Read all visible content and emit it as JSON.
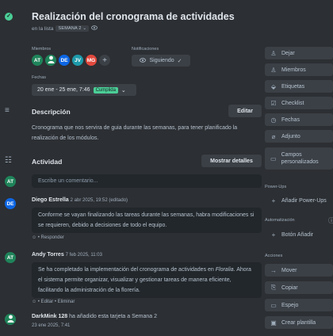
{
  "card": {
    "title": "Realización del cronograma de actividades",
    "in_list_prefix": "en la lista",
    "list_name": "SEMANA 2",
    "list_chevron": "⌄"
  },
  "members": {
    "label": "Miembros",
    "avatars": [
      {
        "initials": "AT",
        "color": "#1f845a"
      },
      {
        "initials": "",
        "color": "#1f845a",
        "icon": "user-icon"
      },
      {
        "initials": "DE",
        "color": "#0c66e4"
      },
      {
        "initials": "JV",
        "color": "#1d9aaa"
      },
      {
        "initials": "MG",
        "color": "#e2483d"
      }
    ]
  },
  "notifications": {
    "label": "Notificaciones",
    "follow_label": "Siguiendo",
    "follow_check": "✓"
  },
  "dates": {
    "label": "Fechas",
    "value": "20 ene - 25 ene, 7:46",
    "status": "Cumplida"
  },
  "description": {
    "title": "Descripción",
    "edit_label": "Editar",
    "text": "Cronograma que nos servira de guia durante las semanas, para tener planificado la realización de los módulos."
  },
  "activity": {
    "title": "Actividad",
    "show_details_label": "Mostrar detalles",
    "comment_placeholder": "Escribe un comentario...",
    "current_user_initials": "AT",
    "current_user_color": "#1f845a",
    "comments": [
      {
        "author": "Diego Estrella",
        "initials": "DE",
        "color": "#0c66e4",
        "meta": "2 abr 2025, 19:52 (editado)",
        "text": "Conforme se vayan finalizando las tareas durante las semanas, habra modificaciones si se requieren, debido a decisiones de todo el equipo.",
        "actions": "☺ • Responder"
      },
      {
        "author": "Andy Torres",
        "initials": "AT",
        "color": "#1f845a",
        "meta": "7 feb 2025, 11:03",
        "text_before": "Se ha completado la implementación del cronograma de actividades en ",
        "text_italic": "Floralia",
        "text_after": ". Ahora el sistema permite organizar, visualizar y gestionar tareas de manera eficiente, facilitando la administración de la florería.",
        "actions": "☺ • Editar • Eliminar"
      }
    ],
    "log": {
      "author": "DarkMink 128",
      "action": "ha añadido esta tarjeta a Semana 2",
      "time": "23 ene 2025, 7:41"
    }
  },
  "sidebar": {
    "buttons": [
      {
        "label": "Dejar",
        "icon": "user-icon"
      },
      {
        "label": "Miembros",
        "icon": "user-icon"
      },
      {
        "label": "Etiquetas",
        "icon": "tag-icon"
      },
      {
        "label": "Checklist",
        "icon": "checklist-icon"
      },
      {
        "label": "Fechas",
        "icon": "clock-icon"
      },
      {
        "label": "Adjunto",
        "icon": "paperclip-icon"
      },
      {
        "label": "Campos personalizados",
        "icon": "fields-icon"
      }
    ],
    "powerups_label": "Power-Ups",
    "add_powerups": "Añadir Power-Ups",
    "automation_label": "Automatización",
    "add_button": "Botón Añadir",
    "actions_label": "Acciones",
    "actions": [
      {
        "label": "Mover",
        "icon": "arrow-right-icon"
      },
      {
        "label": "Copiar",
        "icon": "copy-icon"
      },
      {
        "label": "Espejo",
        "icon": "mirror-icon"
      },
      {
        "label": "Crear plantilla",
        "icon": "template-icon"
      }
    ]
  }
}
